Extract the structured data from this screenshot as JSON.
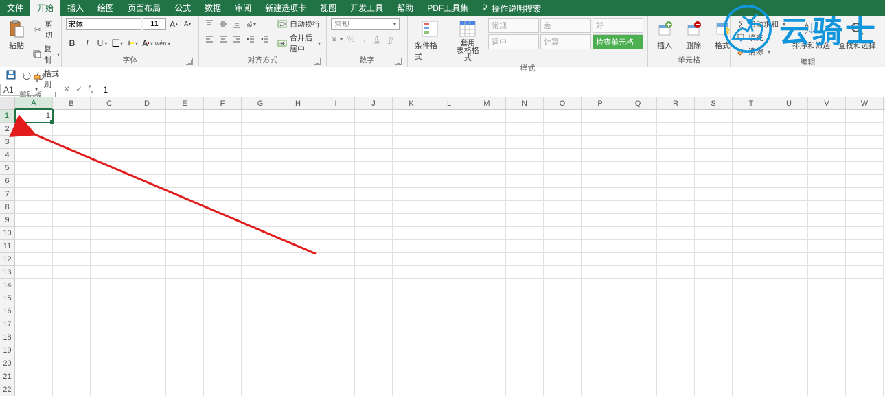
{
  "tabs": {
    "file": "文件",
    "home": "开始",
    "insert": "插入",
    "draw": "绘图",
    "layout": "页面布局",
    "formulas": "公式",
    "data": "数据",
    "review": "审阅",
    "newtab": "新建选项卡",
    "view": "视图",
    "dev": "开发工具",
    "help": "帮助",
    "pdf": "PDF工具集",
    "tellme": "操作说明搜索"
  },
  "ribbon": {
    "clipboard": {
      "paste": "粘贴",
      "cut": "剪切",
      "copy": "复制",
      "painter": "格式刷",
      "group": "剪贴板"
    },
    "font": {
      "name": "宋体",
      "size": "11",
      "group": "字体"
    },
    "align": {
      "wrap": "自动换行",
      "merge": "合并后居中",
      "group": "对齐方式"
    },
    "number": {
      "format": "常规",
      "group": "数字"
    },
    "styles": {
      "cond": "条件格式",
      "table": "套用\n表格格式",
      "s_normal": "常规",
      "s_bad": "差",
      "s_good": "好",
      "s_mid": "适中",
      "s_calc": "计算",
      "s_check": "检查单元格",
      "group": "样式"
    },
    "cells": {
      "insert": "插入",
      "delete": "删除",
      "format": "格式",
      "group": "单元格"
    },
    "editing": {
      "sum": "自动求和",
      "fill": "填充",
      "clear": "清除",
      "sort": "排序和筛选",
      "find": "查找和选择",
      "group": "编辑"
    }
  },
  "fbar": {
    "name": "A1",
    "value": "1"
  },
  "grid": {
    "cols": [
      "A",
      "B",
      "C",
      "D",
      "E",
      "F",
      "G",
      "H",
      "I",
      "J",
      "K",
      "L",
      "M",
      "N",
      "O",
      "P",
      "Q",
      "R",
      "S",
      "T",
      "U",
      "V",
      "W"
    ],
    "activeCell": "1"
  },
  "watermark": "云骑士"
}
